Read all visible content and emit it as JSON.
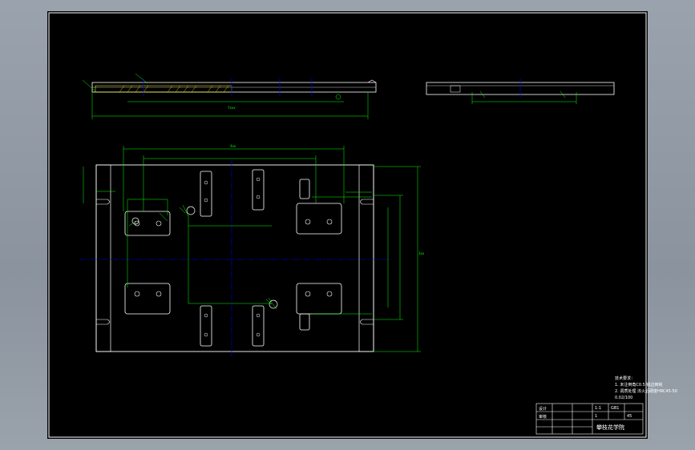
{
  "drawing": {
    "notes": {
      "heading": "技术要求：",
      "line1": "1. 未注倒角C0.5 锐边倒钝",
      "line2": "2. 调质处理 淬火后硬度HRC45-50",
      "line3": "0.02/100"
    },
    "title_block": {
      "designer_label": "设计",
      "check_label": "审核",
      "drawing_no": "GB1",
      "scale": "1:1",
      "sheet": "1",
      "material": "45",
      "school_title": "攀枝花学院"
    },
    "dimensions": {
      "top_view_width": "7xxx",
      "main_width": "4xx",
      "main_height": "3xx"
    }
  },
  "colors": {
    "background": "#000000",
    "outline": "#ffffff",
    "dimension": "#00ff00",
    "centerline": "#0000ff",
    "hatch": "#ffff00"
  }
}
